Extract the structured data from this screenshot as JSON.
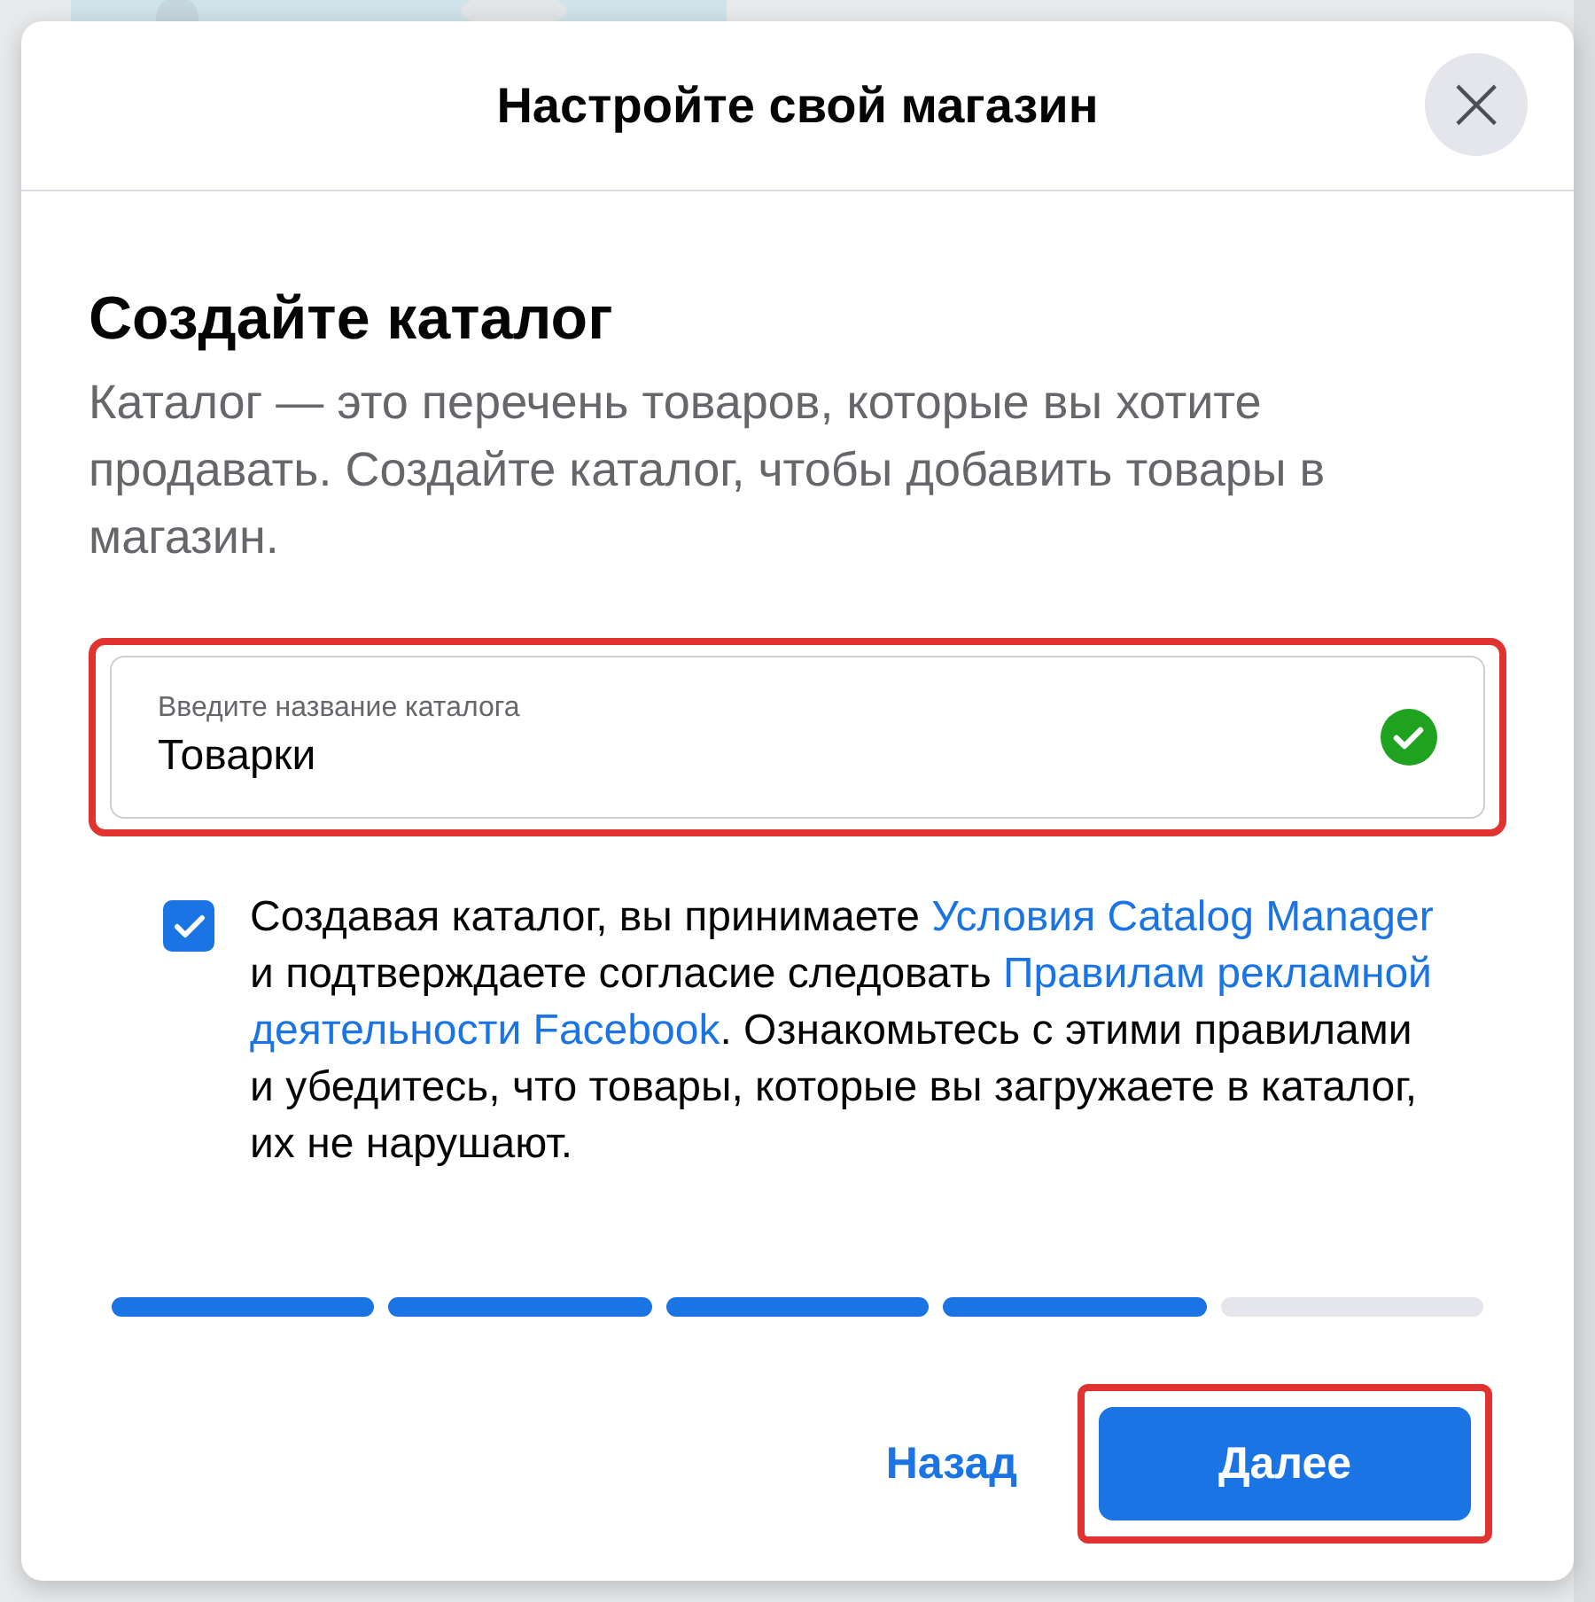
{
  "dialog": {
    "title": "Настройте свой магазин",
    "close_label": "×"
  },
  "heading": "Создайте каталог",
  "description": "Каталог — это перечень товаров, которые вы хотите продавать. Создайте каталог, чтобы добавить товары в магазин.",
  "name_field": {
    "label": "Введите название каталога",
    "value": "Товарки",
    "valid": true,
    "highlighted": true
  },
  "consent": {
    "checked": true,
    "parts": [
      {
        "kind": "text",
        "text": "Создавая каталог, вы принимаете "
      },
      {
        "kind": "link",
        "text": "Условия Catalog Manager"
      },
      {
        "kind": "text",
        "text": " и подтверждаете согласие следовать "
      },
      {
        "kind": "link",
        "text": "Правилам рекламной"
      },
      {
        "kind": "link",
        "text": "деятельности Facebook"
      },
      {
        "kind": "text",
        "text": ". Ознакомьтесь с этими правилами и убедитесь, что товары, которые вы загружаете в каталог, их не нарушают."
      }
    ]
  },
  "progress": [
    {
      "done": true
    },
    {
      "done": true
    },
    {
      "done": true
    },
    {
      "done": true
    },
    {
      "done": false
    }
  ],
  "buttons": [
    {
      "kind": "link",
      "label": "Назад",
      "highlighted": false
    },
    {
      "kind": "primary",
      "label": "Далее",
      "highlighted": true
    }
  ]
}
